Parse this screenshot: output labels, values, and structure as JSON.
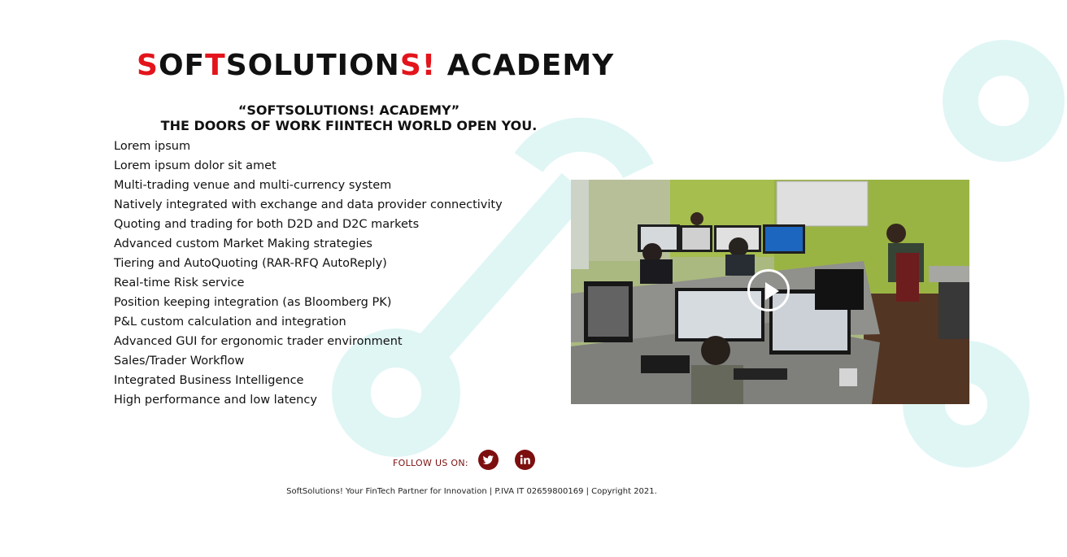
{
  "logo": {
    "part1": "S",
    "part2": "OF",
    "part3": "T",
    "part4": "SOLUTION",
    "part5": "S!",
    "part6": " ACADEMY"
  },
  "tagline": {
    "line1": "“SOFTSOLUTIONS! ACADEMY”",
    "line2": "THE DOORS OF WORK FIINTECH WORLD OPEN YOU."
  },
  "features": [
    "Lorem ipsum",
    "Lorem ipsum dolor sit amet",
    "Multi-trading venue and multi-currency system",
    "Natively integrated with exchange and data provider connectivity",
    "Quoting and trading for both D2D and D2C markets",
    "Advanced custom Market Making strategies",
    "Tiering and AutoQuoting (RAR-RFQ AutoReply)",
    "Real-time Risk service",
    "Position keeping integration (as Bloomberg PK)",
    "P&L custom calculation and integration",
    "Advanced GUI for ergonomic trader environment",
    "Sales/Trader Workflow",
    "Integrated Business Intelligence",
    "High performance and low latency"
  ],
  "video": {
    "icon": "play-icon"
  },
  "social": {
    "follow_label": "FOLLOW US ON:",
    "icons": [
      "twitter-icon",
      "linkedin-icon"
    ]
  },
  "footer": {
    "text": "SoftSolutions! Your FinTech Partner for Innovation | P.IVA IT 02659800169 | Copyright 2021."
  },
  "colors": {
    "brand_red": "#e3141b",
    "social_bg": "#7d0f0f",
    "deco_teal": "#e0f6f5"
  }
}
